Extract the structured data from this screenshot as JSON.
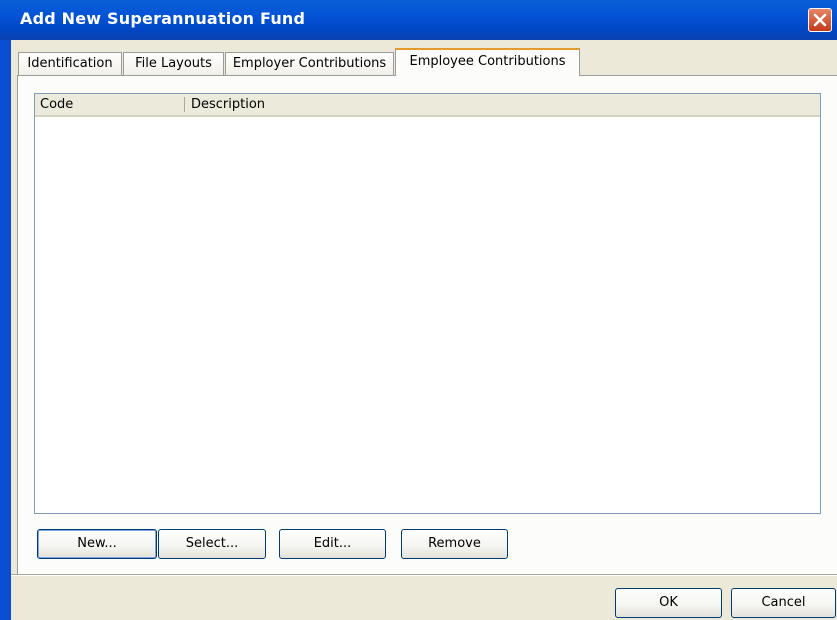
{
  "window": {
    "title": "Add New Superannuation Fund",
    "close_icon": "close-icon"
  },
  "tabs": [
    {
      "label": "Identification",
      "active": false
    },
    {
      "label": "File Layouts",
      "active": false
    },
    {
      "label": "Employer Contributions",
      "active": false
    },
    {
      "label": "Employee Contributions",
      "active": true
    }
  ],
  "list": {
    "columns": [
      "Code",
      "Description"
    ],
    "rows": []
  },
  "panel_buttons": {
    "new": "New...",
    "select": "Select...",
    "edit": "Edit...",
    "remove": "Remove"
  },
  "footer_buttons": {
    "ok": "OK",
    "cancel": "Cancel"
  },
  "colors": {
    "titlebar": "#0453d6",
    "active_tab_accent": "#e69a2e",
    "dialog_bg": "#ece9d8"
  }
}
